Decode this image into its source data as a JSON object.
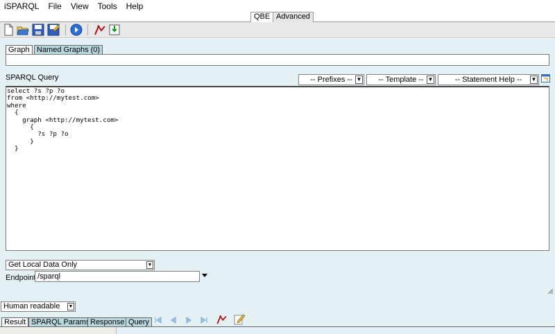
{
  "menubar": {
    "app_name": "iSPARQL",
    "items": [
      "File",
      "View",
      "Tools",
      "Help"
    ]
  },
  "top_tabs": [
    {
      "label": "QBE",
      "active": true
    },
    {
      "label": "Advanced",
      "active": false
    }
  ],
  "toolbar": {
    "icons": [
      "new-document-icon",
      "open-folder-icon",
      "save-icon",
      "save-as-icon",
      "run-query-icon",
      "graph-view-icon",
      "import-icon"
    ]
  },
  "graph_tabs": [
    {
      "label": "Graph",
      "active": true
    },
    {
      "label": "Named Graphs (0)",
      "active": false
    }
  ],
  "query": {
    "label": "SPARQL Query",
    "prefixes": "-- Prefixes --",
    "template": "-- Template --",
    "statement_help": "-- Statement Help --",
    "text": "select ?s ?p ?o\nfrom <http://mytest.com>\nwhere\n  {\n    graph <http://mytest.com>\n      {\n        ?s ?p ?o\n      }\n  }"
  },
  "data_source": {
    "selected": "Get Local Data Only"
  },
  "endpoint": {
    "label": "Endpoint",
    "value": "/sparql"
  },
  "results": {
    "format": "Human readable",
    "tabs": [
      {
        "label": "Result",
        "active": true
      },
      {
        "label": "SPARQL Params",
        "active": false
      },
      {
        "label": "Response",
        "active": false
      },
      {
        "label": "Query",
        "active": false
      }
    ]
  },
  "colors": {
    "panel_background": "#e4f1f4",
    "inactive_tab": "#b9d7df",
    "toolbar": "#e8e8e8"
  }
}
